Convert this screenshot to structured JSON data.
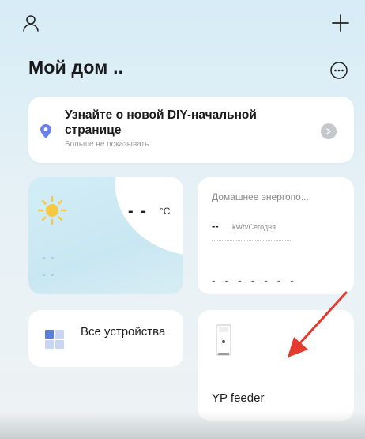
{
  "header": {
    "home_title": "Мой дом .."
  },
  "banner": {
    "title": "Узнайте о новой DIY-начальной странице",
    "subtitle": "Больше не показывать"
  },
  "weather": {
    "temp": "- -",
    "unit": "°C",
    "line_1": "- -",
    "line_2": "- -"
  },
  "energy": {
    "title": "Домашнее энергопо...",
    "value": "--",
    "unit": "kWh/Сегодня",
    "dashes": "- - - - - - -"
  },
  "devices": {
    "label": "Все устройства"
  },
  "feeder": {
    "label": "YP feeder"
  },
  "colors": {
    "background": "#d6ecf6",
    "card": "#ffffff",
    "pin": "#6a7ff0",
    "sun": "#f6c945",
    "arrow": "#e53a2d",
    "grid_dark": "#5a7fd6",
    "grid_light": "#c9d6f3"
  },
  "icons": {
    "user": "user-icon",
    "add": "plus-icon",
    "more": "more-icon",
    "location": "pin-icon",
    "weather": "sun-icon",
    "devices": "grid-icon",
    "feeder": "feeder-icon"
  }
}
